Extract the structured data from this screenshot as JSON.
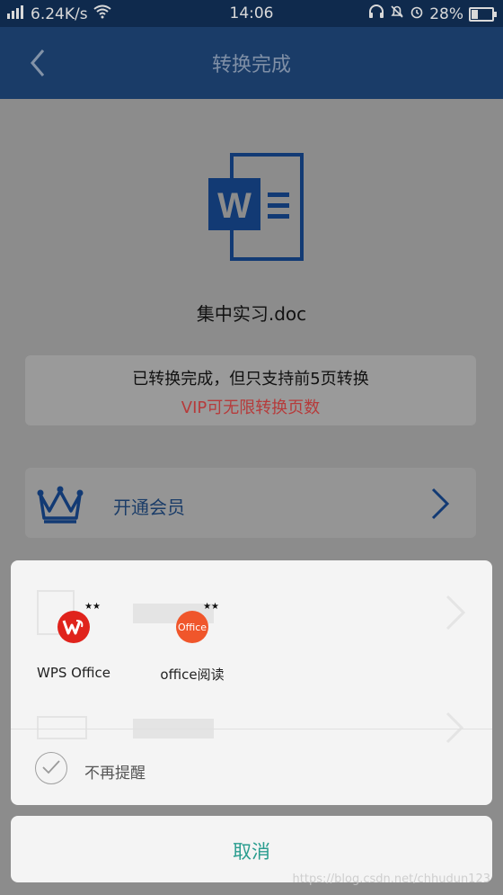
{
  "status_bar": {
    "signal": "4G",
    "speed": "6.24K/s",
    "time": "14:06",
    "battery_percent": "28%",
    "battery_level": 0.28
  },
  "header": {
    "title": "转换完成",
    "back_icon": "chevron-left-icon"
  },
  "document": {
    "icon": "word-document-icon",
    "filename": "集中实习.doc"
  },
  "notice": {
    "line1": "已转换完成，但只支持前5页转换",
    "line2": "VIP可无限转换页数",
    "line2_color": "#b63b3b"
  },
  "vip": {
    "label": "开通会员",
    "icon": "crown-icon"
  },
  "open_with_dialog": {
    "apps": [
      {
        "label": "WPS Office",
        "icon": "wps-office-icon",
        "color": "#e0231c"
      },
      {
        "label": "office阅读",
        "icon": "office-reader-icon",
        "color": "#f0562b",
        "glyph": "Office"
      }
    ],
    "dont_remind_label": "不再提醒",
    "cancel_label": "取消"
  },
  "watermark": "https://blog.csdn.net/chhudun123"
}
